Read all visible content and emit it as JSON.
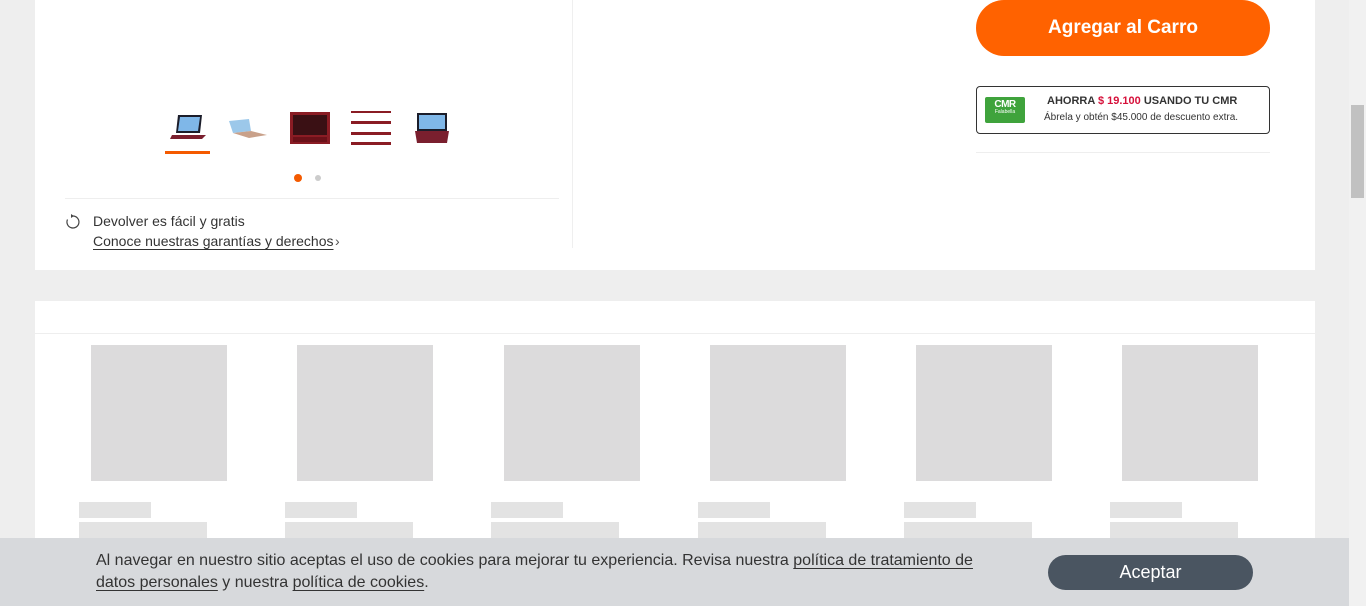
{
  "product": {
    "add_to_cart_label": "Agregar al Carro",
    "return": {
      "title": "Devolver es fácil y gratis",
      "link": "Conoce nuestras garantías y derechos"
    },
    "thumbnails": [
      "laptop-front-thumbnail",
      "laptop-open-thumbnail",
      "keyboard-closeup-thumbnail",
      "laptop-side-stack-thumbnail",
      "laptop-back-thumbnail"
    ],
    "carousel_active_dot": 1,
    "carousel_dot_count": 2
  },
  "cmr": {
    "logo_text": "CMR",
    "logo_sub": "Falabella",
    "prefix": "AHORRA",
    "amount": "$ 19.100",
    "suffix": "USANDO TU CMR",
    "subtext": "Ábrela y obtén $45.000 de descuento extra."
  },
  "colors": {
    "accent": "#ff6200",
    "cmr_green": "#3fa33c",
    "price_red": "#d6103a",
    "button_dark": "#4a5561"
  },
  "cookie": {
    "text_before": "Al navegar en nuestro sitio aceptas el uso de cookies para mejorar tu experiencia. Revisa nuestra ",
    "link1": "política de tratamiento de datos personales",
    "text_middle": " y nuestra ",
    "link2": "política de cookies",
    "text_after": ".",
    "accept_label": "Aceptar"
  }
}
